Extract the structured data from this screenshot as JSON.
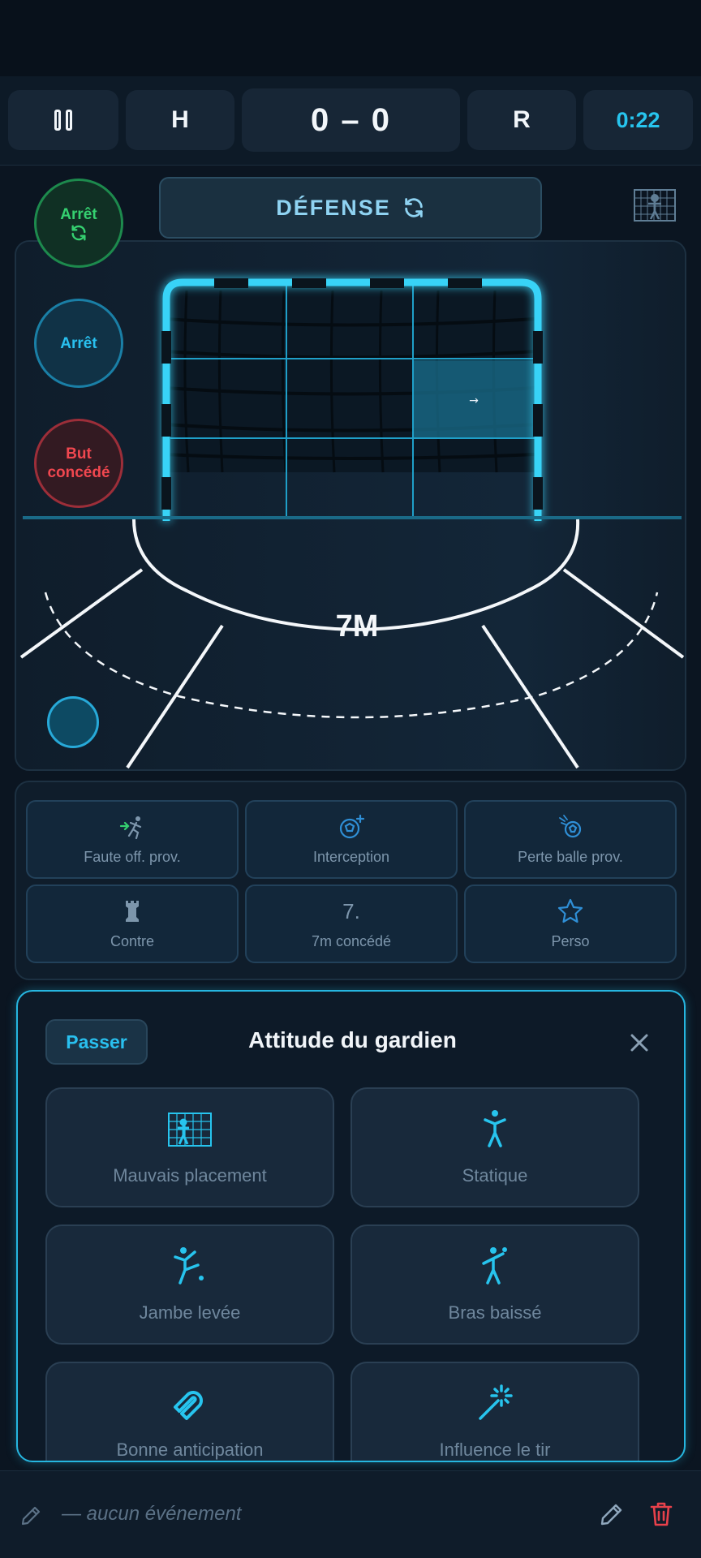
{
  "topbar": {
    "home_label": "H",
    "score": "0 – 0",
    "away_label": "R",
    "timer": "0:22"
  },
  "mode": {
    "label": "DÉFENSE"
  },
  "field": {
    "zone_label": "7M",
    "shot_marker": "→"
  },
  "outcomes": {
    "save_rebound": "Arrêt",
    "save": "Arrêt",
    "goal_conceded_line1": "But",
    "goal_conceded_line2": "concédé"
  },
  "actions": [
    {
      "label": "Faute off. prov.",
      "icon": "offensive-foul-icon"
    },
    {
      "label": "Interception",
      "icon": "ball-plus-icon"
    },
    {
      "label": "Perte balle prov.",
      "icon": "ball-loss-icon"
    },
    {
      "label": "Contre",
      "icon": "chess-rook-icon"
    },
    {
      "label": "7m concédé",
      "icon": "seven-icon",
      "glyph": "7."
    },
    {
      "label": "Perso",
      "icon": "star-icon"
    }
  ],
  "sheet": {
    "skip_label": "Passer",
    "title": "Attitude du gardien",
    "options": [
      {
        "label": "Mauvais placement",
        "icon": "goalkeeper-in-goal-icon"
      },
      {
        "label": "Statique",
        "icon": "standing-person-icon"
      },
      {
        "label": "Jambe levée",
        "icon": "leg-raised-icon"
      },
      {
        "label": "Bras baissé",
        "icon": "arm-lowered-icon"
      },
      {
        "label": "Bonne anticipation",
        "icon": "magnet-icon"
      },
      {
        "label": "Influence le tir",
        "icon": "magic-wand-icon"
      }
    ]
  },
  "bottombar": {
    "event_text": "— aucun événement"
  },
  "colors": {
    "accent": "#27c4ee",
    "save_green": "#35d070",
    "goal_red": "#f0474f",
    "background": "#0b1521"
  }
}
